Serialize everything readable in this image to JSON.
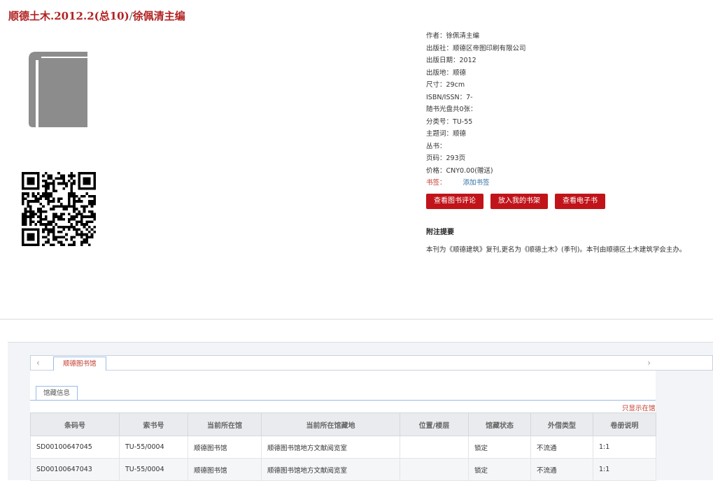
{
  "header": {
    "title_main": "顺德土木.2012.2(总10)",
    "title_sep": "/",
    "title_author": "徐佩清主编"
  },
  "book": {
    "meta": [
      {
        "label": "作者：",
        "value": "徐佩清主编"
      },
      {
        "label": "出版社：",
        "value": "顺德区帝图印刷有限公司"
      },
      {
        "label": "出版日期：",
        "value": "2012"
      },
      {
        "label": "出版地：",
        "value": "顺德"
      },
      {
        "label": "尺寸：",
        "value": "29cm"
      },
      {
        "label": "ISBN/ISSN：",
        "value": "7-"
      },
      {
        "label": "随书光盘共0张：",
        "value": ""
      },
      {
        "label": "分类号：",
        "value": "TU-55"
      },
      {
        "label": "主题词：",
        "value": "顺德"
      },
      {
        "label": "丛书：",
        "value": ""
      },
      {
        "label": "页码：",
        "value": "293页"
      },
      {
        "label": "价格：",
        "value": "CNY0.00(赠送)"
      }
    ],
    "bookmark_label": "书签：",
    "add_bookmark": "添加书签",
    "buttons": {
      "review": "查看图书评论",
      "shelf": "放入我的书架",
      "ebook": "查看电子书"
    },
    "notes_title": "附注提要",
    "notes_text": "本刊为《顺德建筑》复刊,更名为《顺德土木》(季刊)。本刊由顺德区土木建筑学会主办。"
  },
  "tabs": {
    "library": "顺德图书馆",
    "collection_info": "馆藏信息",
    "only_available": "只显示在馆",
    "prev": "‹",
    "next": "›"
  },
  "holdings": {
    "headers": [
      "条码号",
      "索书号",
      "当前所在馆",
      "当前所在馆藏地",
      "位置/楼层",
      "馆藏状态",
      "外借类型",
      "卷册说明"
    ],
    "rows": [
      [
        "SD00100647045",
        "TU-55/0004",
        "顺德图书馆",
        "顺德图书馆地方文献阅览室",
        "",
        "锁定",
        "不流通",
        "1:1"
      ],
      [
        "SD00100647043",
        "TU-55/0004",
        "顺德图书馆",
        "顺德图书馆地方文献阅览室",
        "",
        "锁定",
        "不流通",
        "1:1"
      ]
    ]
  },
  "colors": {
    "accent": "#c0141a",
    "title": "#b22222",
    "link": "#2e6da4"
  }
}
